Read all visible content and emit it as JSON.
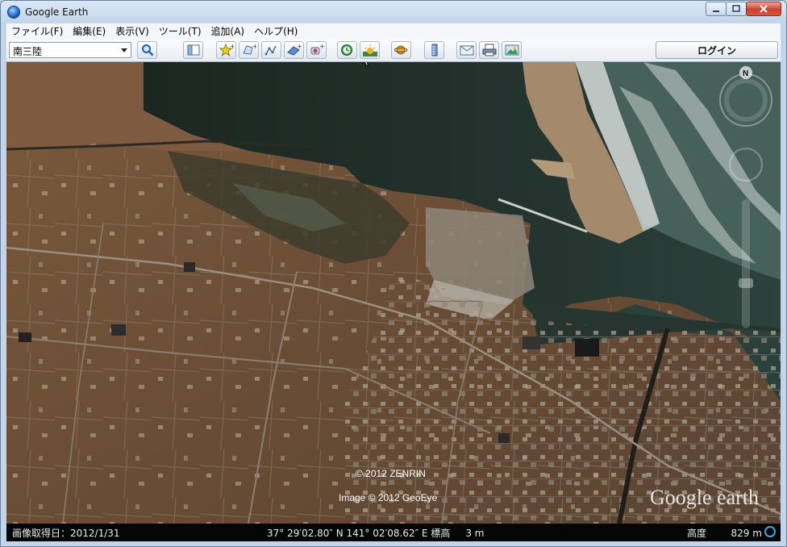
{
  "window": {
    "title": "Google Earth",
    "controls": {
      "minimize": "▭",
      "maximize": "□",
      "close": "✕"
    }
  },
  "menu": [
    {
      "label": "ファイル(F)"
    },
    {
      "label": "編集(E)"
    },
    {
      "label": "表示(V)"
    },
    {
      "label": "ツール(T)"
    },
    {
      "label": "追加(A)"
    },
    {
      "label": "ヘルプ(H)"
    }
  ],
  "toolbar": {
    "search_value": "南三陸",
    "login_label": "ログイン",
    "icons": [
      "search-icon",
      "sidebar-toggle-icon",
      "placemark-icon",
      "polygon-icon",
      "path-icon",
      "image-overlay-icon",
      "record-tour-icon",
      "historical-imagery-icon",
      "sunlight-icon",
      "planet-switch-icon",
      "ruler-icon",
      "email-icon",
      "print-icon",
      "save-image-icon"
    ]
  },
  "map": {
    "compass_label": "N",
    "copyright_1": "© 2012 ZENRIN",
    "copyright_2": "Image © 2012 GeoEye",
    "logo_text": "Google earth"
  },
  "status": {
    "imagery_date": "画像取得日：2012/1/31",
    "coordinates": "37° 29′02.80″ N 141° 02′08.62″ E 標高     3 m",
    "altitude": "高度        829 m"
  },
  "colors": {
    "ocean": "#1f2e28",
    "surf": "#d9dedc",
    "land": "#6a4f37",
    "statusbar": "#050607",
    "title_bg": "#c3d5ea"
  }
}
